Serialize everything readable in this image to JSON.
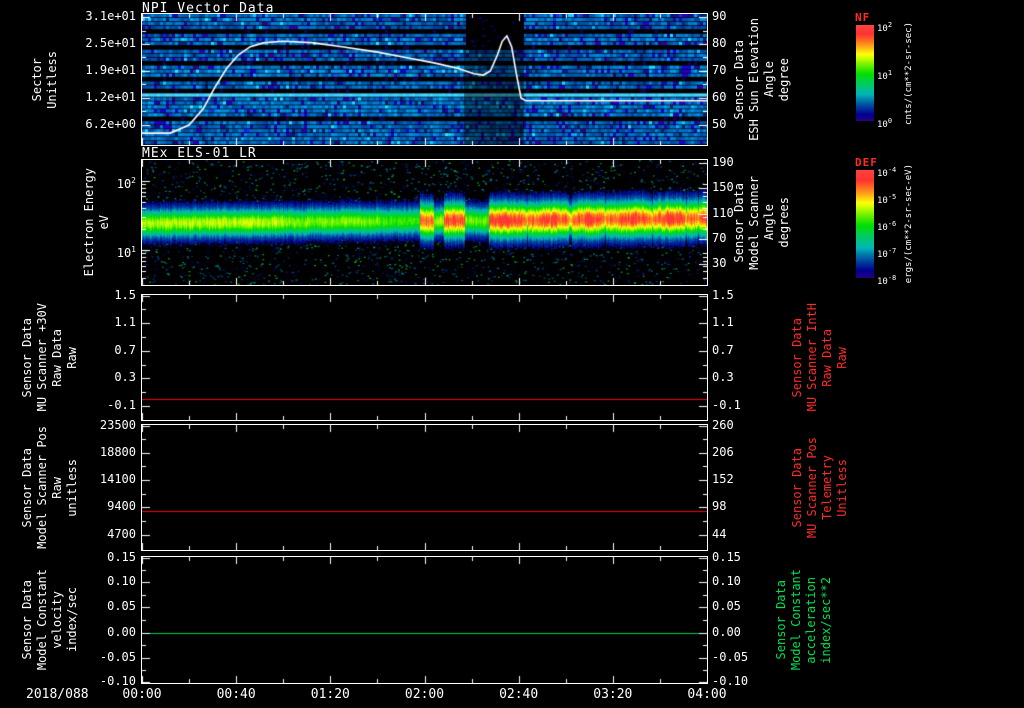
{
  "window": {
    "background": "#000000"
  },
  "x_axis": {
    "date_label": "2018/088",
    "tick_labels": [
      "00:00",
      "00:40",
      "01:20",
      "02:00",
      "02:40",
      "03:20",
      "04:00"
    ]
  },
  "panels": [
    {
      "title": "NPI Vector Data",
      "left_axis": {
        "label_lines": [
          "Sector",
          "Unitless"
        ],
        "ticks": [
          "3.1e+01",
          "2.5e+01",
          "1.9e+01",
          "1.2e+01",
          "6.2e+00"
        ],
        "color": "#ffffff"
      },
      "right_axis": {
        "label_lines": [
          "Sensor Data",
          "ESH Sun Elevation",
          "Angle",
          "degree"
        ],
        "ticks": [
          "90",
          "80",
          "70",
          "60",
          "50"
        ],
        "color": "#ffffff"
      }
    },
    {
      "title": "MEx ELS-01 LR",
      "left_axis": {
        "label_lines": [
          "Electron Energy",
          "eV"
        ],
        "ticks": [
          "10^2",
          "10^1"
        ],
        "color": "#ffffff"
      },
      "right_axis": {
        "label_lines": [
          "Sensor Data",
          "Model Scanner",
          "Angle",
          "degrees"
        ],
        "ticks": [
          "190",
          "150",
          "110",
          "70",
          "30"
        ],
        "color": "#ffffff"
      }
    },
    {
      "title": "",
      "left_axis": {
        "label_lines": [
          "Sensor Data",
          "MU Scanner +30V",
          "Raw Data",
          "Raw"
        ],
        "ticks": [
          "1.5",
          "1.1",
          "0.7",
          "0.3",
          "-0.1"
        ],
        "color": "#ffffff"
      },
      "right_axis": {
        "label_lines": [
          "Sensor Data",
          "MU Scanner IntH",
          "Raw Data",
          "Raw"
        ],
        "ticks": [
          "1.5",
          "1.1",
          "0.7",
          "0.3",
          "-0.1"
        ],
        "color": "#ff2a2a"
      }
    },
    {
      "title": "",
      "left_axis": {
        "label_lines": [
          "Sensor Data",
          "Model Scanner Pos",
          "Raw",
          "unitless"
        ],
        "ticks": [
          "23500",
          "18800",
          "14100",
          "9400",
          "4700"
        ],
        "color": "#ffffff"
      },
      "right_axis": {
        "label_lines": [
          "Sensor Data",
          "MU Scanner Pos",
          "Telemetry",
          "Unitless"
        ],
        "ticks": [
          "260",
          "206",
          "152",
          "98",
          "44"
        ],
        "color": "#ff2a2a"
      }
    },
    {
      "title": "",
      "left_axis": {
        "label_lines": [
          "Sensor Data",
          "Model Constant",
          "velocity",
          "index/sec"
        ],
        "ticks": [
          "0.15",
          "0.10",
          "0.05",
          "0.00",
          "-0.05",
          "-0.10"
        ],
        "color": "#ffffff"
      },
      "right_axis": {
        "label_lines": [
          "Sensor Data",
          "Model Constant",
          "acceleration",
          "index/sec**2"
        ],
        "ticks": [
          "0.15",
          "0.10",
          "0.05",
          "0.00",
          "-0.05",
          "-0.10"
        ],
        "color": "#00e050"
      }
    }
  ],
  "colorbars": [
    {
      "title": "NF",
      "title_color": "#ff2a2a",
      "unit": "cnts/(cm**2-sr-sec)",
      "tick_labels": [
        "10^2",
        "10^1",
        "10^0"
      ]
    },
    {
      "title": "DEF",
      "title_color": "#ff2a2a",
      "unit": "ergs/(cm**2-sr-sec-eV)",
      "tick_labels": [
        "10^-4",
        "10^-5",
        "10^-6",
        "10^-7",
        "10^-8"
      ]
    }
  ],
  "chart_data": [
    {
      "panel": "NPI Vector Data",
      "type": "heatmap",
      "x_range": [
        "00:00",
        "04:00"
      ],
      "x_unit": "UT on 2018/088",
      "y_axis": "Sector (Unitless)",
      "y_tick_values": [
        31,
        25,
        19,
        12,
        6.2
      ],
      "colorbar": "NF, cnts/(cm**2-sr-sec), log scale 10^0 to 10^2",
      "features": [
        "banded blue/cyan count rates across all sectors for the full interval",
        "black data-gap blob near 02:15-02:25 in upper sectors with darker column below",
        "one bright cyan sector row in the lower quarter of the panel"
      ],
      "overlay_line": {
        "name": "ESH Sun Elevation Angle (degree)",
        "color": "#ffffff",
        "points": [
          [
            0,
            47
          ],
          [
            12,
            47
          ],
          [
            20,
            50
          ],
          [
            26,
            56
          ],
          [
            31,
            64
          ],
          [
            36,
            71
          ],
          [
            41,
            76
          ],
          [
            46,
            79
          ],
          [
            52,
            80.5
          ],
          [
            60,
            81
          ],
          [
            72,
            80.5
          ],
          [
            85,
            79
          ],
          [
            100,
            77
          ],
          [
            112,
            75
          ],
          [
            124,
            73
          ],
          [
            134,
            71
          ],
          [
            141,
            69
          ],
          [
            145,
            68.5
          ],
          [
            148,
            70
          ],
          [
            151,
            76
          ],
          [
            153,
            81
          ],
          [
            155,
            83
          ],
          [
            157,
            79
          ],
          [
            159,
            69
          ],
          [
            161,
            60
          ],
          [
            163,
            59
          ],
          [
            200,
            59
          ],
          [
            240,
            59
          ]
        ]
      }
    },
    {
      "panel": "MEx ELS-01 LR",
      "type": "heatmap",
      "y_axis": "Electron Energy (eV), log scale",
      "colorbar": "DEF, ergs/(cm**2-sr-sec-eV), log scale 10^-8 to 10^-4",
      "band": {
        "center_energy_eV": 25,
        "description": "continuous electron band: green/yellow 00:00-01:40, weaker green 01:40-02:00, intense red bursts 02:00-02:17, brief weakening 02:17-02:27, strong continuous red band 02:28-04:00, sparse blue noise elsewhere",
        "segments": [
          {
            "t": [
              0,
              60
            ],
            "level": 0.65
          },
          {
            "t": [
              60,
              100
            ],
            "level": 0.6
          },
          {
            "t": [
              100,
              118
            ],
            "level": 0.55
          },
          {
            "t": [
              118,
              124
            ],
            "level": 0.85
          },
          {
            "t": [
              124,
              128
            ],
            "level": 0.62
          },
          {
            "t": [
              128,
              137
            ],
            "level": 0.9
          },
          {
            "t": [
              137,
              147
            ],
            "level": 0.58
          },
          {
            "t": [
              147,
              158
            ],
            "level": 0.92
          },
          {
            "t": [
              158,
              240
            ],
            "level": 0.88
          }
        ]
      }
    },
    {
      "panel": "Sensor Data MU Scanner +30V Raw Data",
      "type": "line",
      "color": "#ff0000",
      "ylim": [
        -0.3,
        1.5
      ],
      "ytick_values": [
        1.5,
        1.1,
        0.7,
        0.3,
        -0.1
      ],
      "value": 0.0
    },
    {
      "panel": "Sensor Data Model Scanner Pos Raw",
      "type": "line",
      "color": "#ff0000",
      "ylim": [
        2100,
        23500
      ],
      "ytick_values": [
        23500,
        18800,
        14100,
        9400,
        4700
      ],
      "value": 8700
    },
    {
      "panel": "Sensor Data Model Constant velocity",
      "type": "line",
      "color": "#00d045",
      "ylim": [
        -0.1,
        0.15
      ],
      "ytick_values": [
        0.15,
        0.1,
        0.05,
        0.0,
        -0.05,
        -0.1
      ],
      "value": 0.0
    }
  ]
}
